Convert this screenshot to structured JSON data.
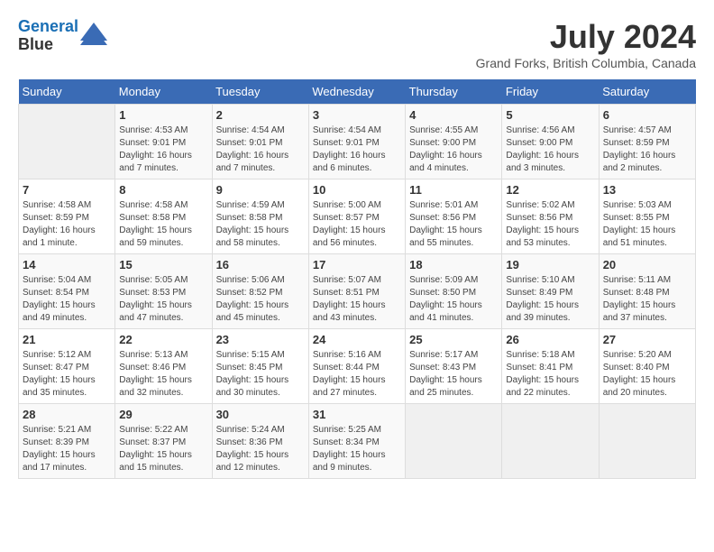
{
  "header": {
    "logo_line1": "General",
    "logo_line2": "Blue",
    "month_year": "July 2024",
    "location": "Grand Forks, British Columbia, Canada"
  },
  "weekdays": [
    "Sunday",
    "Monday",
    "Tuesday",
    "Wednesday",
    "Thursday",
    "Friday",
    "Saturday"
  ],
  "weeks": [
    [
      {
        "day": "",
        "empty": true
      },
      {
        "day": "1",
        "sunrise": "4:53 AM",
        "sunset": "9:01 PM",
        "daylight": "16 hours and 7 minutes."
      },
      {
        "day": "2",
        "sunrise": "4:54 AM",
        "sunset": "9:01 PM",
        "daylight": "16 hours and 7 minutes."
      },
      {
        "day": "3",
        "sunrise": "4:54 AM",
        "sunset": "9:01 PM",
        "daylight": "16 hours and 6 minutes."
      },
      {
        "day": "4",
        "sunrise": "4:55 AM",
        "sunset": "9:00 PM",
        "daylight": "16 hours and 4 minutes."
      },
      {
        "day": "5",
        "sunrise": "4:56 AM",
        "sunset": "9:00 PM",
        "daylight": "16 hours and 3 minutes."
      },
      {
        "day": "6",
        "sunrise": "4:57 AM",
        "sunset": "8:59 PM",
        "daylight": "16 hours and 2 minutes."
      }
    ],
    [
      {
        "day": "7",
        "sunrise": "4:58 AM",
        "sunset": "8:59 PM",
        "daylight": "16 hours and 1 minute."
      },
      {
        "day": "8",
        "sunrise": "4:58 AM",
        "sunset": "8:58 PM",
        "daylight": "15 hours and 59 minutes."
      },
      {
        "day": "9",
        "sunrise": "4:59 AM",
        "sunset": "8:58 PM",
        "daylight": "15 hours and 58 minutes."
      },
      {
        "day": "10",
        "sunrise": "5:00 AM",
        "sunset": "8:57 PM",
        "daylight": "15 hours and 56 minutes."
      },
      {
        "day": "11",
        "sunrise": "5:01 AM",
        "sunset": "8:56 PM",
        "daylight": "15 hours and 55 minutes."
      },
      {
        "day": "12",
        "sunrise": "5:02 AM",
        "sunset": "8:56 PM",
        "daylight": "15 hours and 53 minutes."
      },
      {
        "day": "13",
        "sunrise": "5:03 AM",
        "sunset": "8:55 PM",
        "daylight": "15 hours and 51 minutes."
      }
    ],
    [
      {
        "day": "14",
        "sunrise": "5:04 AM",
        "sunset": "8:54 PM",
        "daylight": "15 hours and 49 minutes."
      },
      {
        "day": "15",
        "sunrise": "5:05 AM",
        "sunset": "8:53 PM",
        "daylight": "15 hours and 47 minutes."
      },
      {
        "day": "16",
        "sunrise": "5:06 AM",
        "sunset": "8:52 PM",
        "daylight": "15 hours and 45 minutes."
      },
      {
        "day": "17",
        "sunrise": "5:07 AM",
        "sunset": "8:51 PM",
        "daylight": "15 hours and 43 minutes."
      },
      {
        "day": "18",
        "sunrise": "5:09 AM",
        "sunset": "8:50 PM",
        "daylight": "15 hours and 41 minutes."
      },
      {
        "day": "19",
        "sunrise": "5:10 AM",
        "sunset": "8:49 PM",
        "daylight": "15 hours and 39 minutes."
      },
      {
        "day": "20",
        "sunrise": "5:11 AM",
        "sunset": "8:48 PM",
        "daylight": "15 hours and 37 minutes."
      }
    ],
    [
      {
        "day": "21",
        "sunrise": "5:12 AM",
        "sunset": "8:47 PM",
        "daylight": "15 hours and 35 minutes."
      },
      {
        "day": "22",
        "sunrise": "5:13 AM",
        "sunset": "8:46 PM",
        "daylight": "15 hours and 32 minutes."
      },
      {
        "day": "23",
        "sunrise": "5:15 AM",
        "sunset": "8:45 PM",
        "daylight": "15 hours and 30 minutes."
      },
      {
        "day": "24",
        "sunrise": "5:16 AM",
        "sunset": "8:44 PM",
        "daylight": "15 hours and 27 minutes."
      },
      {
        "day": "25",
        "sunrise": "5:17 AM",
        "sunset": "8:43 PM",
        "daylight": "15 hours and 25 minutes."
      },
      {
        "day": "26",
        "sunrise": "5:18 AM",
        "sunset": "8:41 PM",
        "daylight": "15 hours and 22 minutes."
      },
      {
        "day": "27",
        "sunrise": "5:20 AM",
        "sunset": "8:40 PM",
        "daylight": "15 hours and 20 minutes."
      }
    ],
    [
      {
        "day": "28",
        "sunrise": "5:21 AM",
        "sunset": "8:39 PM",
        "daylight": "15 hours and 17 minutes."
      },
      {
        "day": "29",
        "sunrise": "5:22 AM",
        "sunset": "8:37 PM",
        "daylight": "15 hours and 15 minutes."
      },
      {
        "day": "30",
        "sunrise": "5:24 AM",
        "sunset": "8:36 PM",
        "daylight": "15 hours and 12 minutes."
      },
      {
        "day": "31",
        "sunrise": "5:25 AM",
        "sunset": "8:34 PM",
        "daylight": "15 hours and 9 minutes."
      },
      {
        "day": "",
        "empty": true
      },
      {
        "day": "",
        "empty": true
      },
      {
        "day": "",
        "empty": true
      }
    ]
  ],
  "labels": {
    "sunrise": "Sunrise:",
    "sunset": "Sunset:",
    "daylight": "Daylight:"
  }
}
